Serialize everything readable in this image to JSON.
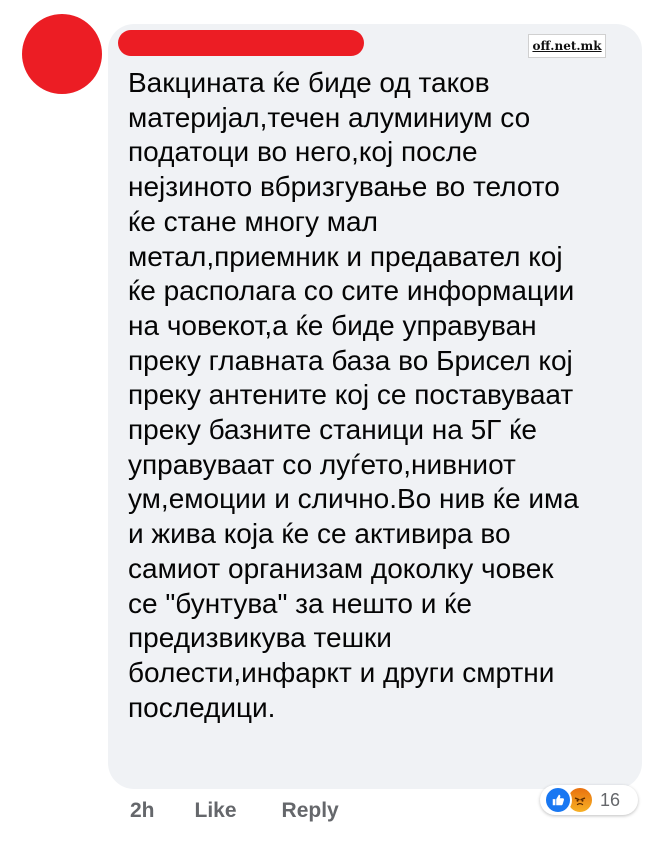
{
  "watermark": "off.net.mk",
  "comment": {
    "lines": [
      "Вакцината ќе биде од таков",
      "материјал,течен алуминиум со",
      "податоци во него,кој после",
      "нејзиното вбризгување во телото",
      "ќе стане многу мал",
      "метал,приемник и предавател кој",
      "ќе располага со сите информации",
      "на човекот,а ќе биде управуван",
      "преку главната база во Брисел кој",
      "преку антените кој се поставуваат",
      "преку базните станици на 5Г ќе",
      "управуваат со луѓето,нивниот",
      "ум,емоции и слично.Во нив ќе има",
      "и жива која ќе се активира во",
      "самиот организам доколку човек",
      "се \"бунтува\" за нешто и ќе",
      "предизвикува тешки",
      "болести,инфаркт и други смртни",
      "последици."
    ]
  },
  "actions": {
    "time": "2h",
    "like_label": "Like",
    "reply_label": "Reply"
  },
  "reactions": {
    "icons": [
      "like-icon",
      "angry-icon"
    ],
    "count": "16"
  },
  "colors": {
    "redaction": "#ec1d24",
    "bubble": "#f0f2f5",
    "text": "#050505",
    "secondary_text": "#65676b",
    "like_blue": "#1877f2"
  }
}
